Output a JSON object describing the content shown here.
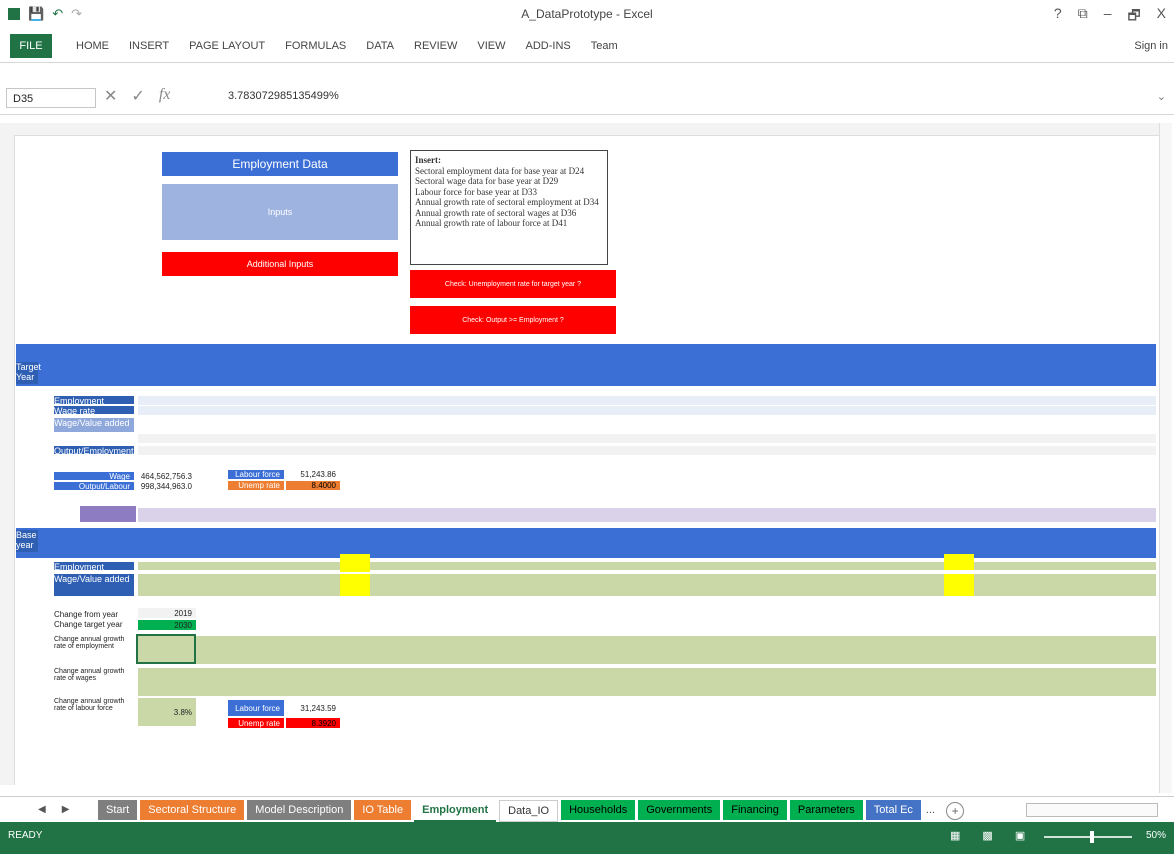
{
  "window": {
    "title": "A_DataPrototype - Excel",
    "controls": [
      "?",
      "⧉",
      "–",
      "🗗",
      "X"
    ]
  },
  "quick_access": {
    "icons": [
      "excel-icon",
      "save-icon",
      "undo-icon",
      "redo-icon"
    ]
  },
  "ribbon": {
    "file_label": "FILE",
    "tabs": [
      "HOME",
      "INSERT",
      "PAGE LAYOUT",
      "FORMULAS",
      "DATA",
      "REVIEW",
      "VIEW",
      "ADD-INS",
      "Team"
    ],
    "signin": "Sign in"
  },
  "formula_bar": {
    "name_box": "D35",
    "value": "3.783072985135499%"
  },
  "sheet": {
    "employment_title": "Employment Data",
    "box2_label": "Inputs",
    "additional_label": "Additional Inputs",
    "insert_title": "Insert:",
    "insert_lines": [
      "Sectoral employment data for base year at D24",
      "Sectoral wage data for base year at D29",
      "Labour force for base year at D33",
      "Annual growth rate of sectoral employment at D34",
      "Annual growth rate of sectoral wages at D36",
      "Annual growth rate of labour force at D41"
    ],
    "check1": "Check: Unemployment rate for target year ?",
    "check2": "Check: Output >= Employment ?",
    "row_labels_top": [
      "Target Year",
      "Employment",
      "Wage rate",
      "Wage/Value added",
      "Output/Employment"
    ],
    "row_labels_base": [
      "Base year",
      "Employment",
      "Wage/Value added"
    ],
    "mid_labels": [
      "Wage",
      "Output/Labour",
      "Labour force",
      "Unemp rate"
    ],
    "mid_values": [
      "464,562,756.3",
      "998,344,963.0",
      "51,243.86",
      "8.4000"
    ],
    "years_labels": [
      "Change from year",
      "Change target year"
    ],
    "years_values": [
      "2019",
      "2030"
    ],
    "growth_labels": [
      "Change annual growth rate of employment",
      "Change annual growth rate of wages",
      "Change annual growth rate of labour force"
    ],
    "growth_value": "3.8%",
    "lower_values": [
      "Labour force",
      "31,243.59",
      "Unemp rate",
      "8.3920"
    ]
  },
  "sheet_tabs": [
    {
      "label": "Start",
      "color": "#7f7f7f"
    },
    {
      "label": "Sectoral Structure",
      "color": "#ed7d31"
    },
    {
      "label": "Model Description",
      "color": "#7f7f7f"
    },
    {
      "label": "IO Table",
      "color": "#ed7d31"
    },
    {
      "label": "Employment",
      "color": "#ffffff",
      "active": true
    },
    {
      "label": "Data_IO",
      "color": "#ffffff"
    },
    {
      "label": "Households",
      "color": "#00b050"
    },
    {
      "label": "Governments",
      "color": "#00b050"
    },
    {
      "label": "Financing",
      "color": "#00b050"
    },
    {
      "label": "Parameters",
      "color": "#00b050"
    },
    {
      "label": "Total Ec",
      "color": "#4472c4"
    }
  ],
  "sheet_more": "...",
  "status": {
    "ready": "READY",
    "zoom": "50%"
  },
  "colors": {
    "excel_green": "#217346",
    "blue_header": "#3b6fd6",
    "light_blue": "#9fb3e0",
    "red": "#ff0000",
    "green_cells": "#c9d8a6"
  }
}
